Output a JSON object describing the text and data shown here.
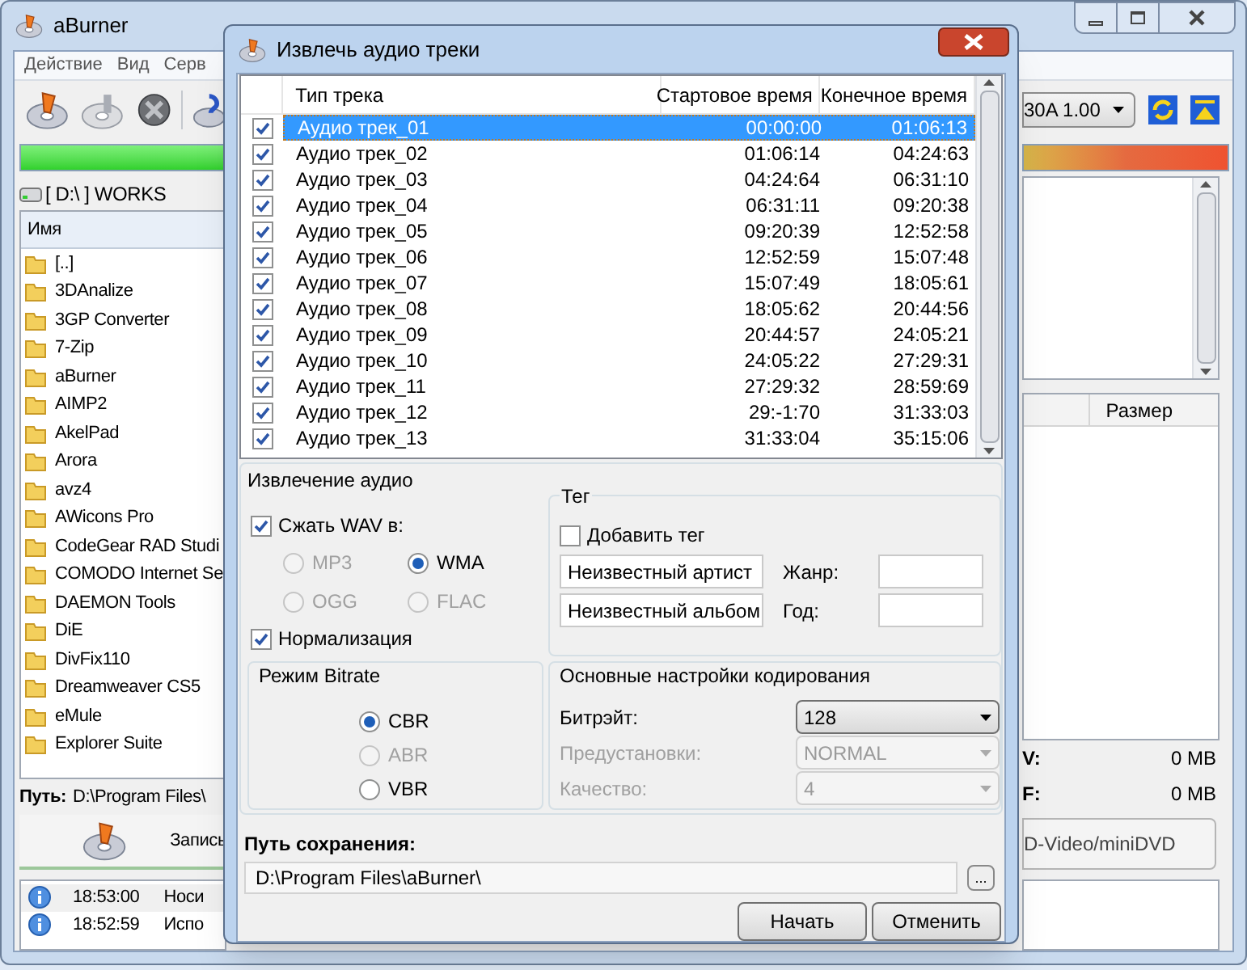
{
  "main_window": {
    "title": "aBurner",
    "menu": [
      "Действие",
      "Вид",
      "Серв"
    ],
    "drive": "[ D:\\ ] WORKS",
    "file_list": {
      "column": "Имя",
      "items": [
        "[..]",
        "3DAnalize",
        "3GP Converter",
        "7-Zip",
        "aBurner",
        "AIMP2",
        "AkelPad",
        "Arora",
        "avz4",
        "AWicons Pro",
        "CodeGear RAD Studi",
        "COMODO Internet Se",
        "DAEMON Tools",
        "DiE",
        "DivFix110",
        "Dreamweaver CS5",
        "eMule",
        "Explorer Suite"
      ]
    },
    "path_label": "Путь:",
    "path": "D:\\Program Files\\",
    "burn_button": "Запись",
    "log": [
      {
        "time": "18:53:00",
        "text": "Носи"
      },
      {
        "time": "18:52:59",
        "text": "Испо"
      }
    ],
    "device": "30A 1.00",
    "size_column": "Размер",
    "stats": [
      {
        "label": "V:",
        "value": "0 MB"
      },
      {
        "label": "F:",
        "value": "0 MB"
      }
    ],
    "format_button": "D-Video/miniDVD"
  },
  "dialog": {
    "title": "Извлечь аудио треки",
    "tracks": {
      "columns": [
        "Тип трека",
        "Стартовое время",
        "Конечное время"
      ],
      "rows": [
        {
          "name": "Аудио трек_01",
          "start": "00:00:00",
          "end": "01:06:13",
          "checked": true,
          "selected": true
        },
        {
          "name": "Аудио трек_02",
          "start": "01:06:14",
          "end": "04:24:63",
          "checked": true,
          "selected": false
        },
        {
          "name": "Аудио трек_03",
          "start": "04:24:64",
          "end": "06:31:10",
          "checked": true,
          "selected": false
        },
        {
          "name": "Аудио трек_04",
          "start": "06:31:11",
          "end": "09:20:38",
          "checked": true,
          "selected": false
        },
        {
          "name": "Аудио трек_05",
          "start": "09:20:39",
          "end": "12:52:58",
          "checked": true,
          "selected": false
        },
        {
          "name": "Аудио трек_06",
          "start": "12:52:59",
          "end": "15:07:48",
          "checked": true,
          "selected": false
        },
        {
          "name": "Аудио трек_07",
          "start": "15:07:49",
          "end": "18:05:61",
          "checked": true,
          "selected": false
        },
        {
          "name": "Аудио трек_08",
          "start": "18:05:62",
          "end": "20:44:56",
          "checked": true,
          "selected": false
        },
        {
          "name": "Аудио трек_09",
          "start": "20:44:57",
          "end": "24:05:21",
          "checked": true,
          "selected": false
        },
        {
          "name": "Аудио трек_10",
          "start": "24:05:22",
          "end": "27:29:31",
          "checked": true,
          "selected": false
        },
        {
          "name": "Аудио трек_11",
          "start": "27:29:32",
          "end": "28:59:69",
          "checked": true,
          "selected": false
        },
        {
          "name": "Аудио трек_12",
          "start": "29:-1:70",
          "end": "31:33:03",
          "checked": true,
          "selected": false
        },
        {
          "name": "Аудио трек_13",
          "start": "31:33:04",
          "end": "35:15:06",
          "checked": true,
          "selected": false
        }
      ]
    },
    "extraction": {
      "title": "Извлечение аудио",
      "compress": {
        "label": "Сжать WAV в:",
        "checked": true
      },
      "formats": [
        {
          "label": "MP3",
          "selected": false,
          "disabled": true
        },
        {
          "label": "WMA",
          "selected": true,
          "disabled": false
        },
        {
          "label": "OGG",
          "selected": false,
          "disabled": true
        },
        {
          "label": "FLAC",
          "selected": false,
          "disabled": true
        }
      ],
      "normalize": {
        "label": "Нормализация",
        "checked": true
      }
    },
    "tag": {
      "title": "Тег",
      "add": {
        "label": "Добавить тег",
        "checked": false
      },
      "artist": "Неизвестный артист",
      "album": "Неизвестный альбом",
      "genre_label": "Жанр:",
      "year_label": "Год:"
    },
    "bitrate_mode": {
      "title": "Режим Bitrate",
      "options": [
        {
          "label": "CBR",
          "selected": true,
          "disabled": false
        },
        {
          "label": "ABR",
          "selected": false,
          "disabled": true
        },
        {
          "label": "VBR",
          "selected": false,
          "disabled": false
        }
      ]
    },
    "encoding": {
      "title": "Основные настройки кодирования",
      "settings": [
        {
          "label": "Битрэйт:",
          "value": "128",
          "disabled": false
        },
        {
          "label": "Предустановки:",
          "value": "NORMAL",
          "disabled": true
        },
        {
          "label": "Качество:",
          "value": "4",
          "disabled": true
        }
      ]
    },
    "save_path": {
      "label": "Путь сохранения:",
      "value": "D:\\Program Files\\aBurner\\",
      "browse": "..."
    },
    "buttons": [
      "Начать",
      "Отменить"
    ]
  }
}
